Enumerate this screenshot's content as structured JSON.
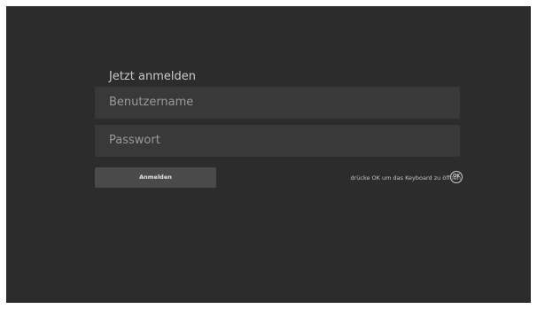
{
  "login": {
    "title": "Jetzt anmelden",
    "username_placeholder": "Benutzername",
    "password_placeholder": "Passwort",
    "submit_label": "Anmelden",
    "keyboard_hint": "drücke OK um das Keyboard zu öffnen",
    "ok_icon_label": "OK"
  },
  "colors": {
    "background": "#2c2c2c",
    "field": "#393939",
    "button": "#4a4a4a",
    "text": "#c9c9c9"
  }
}
